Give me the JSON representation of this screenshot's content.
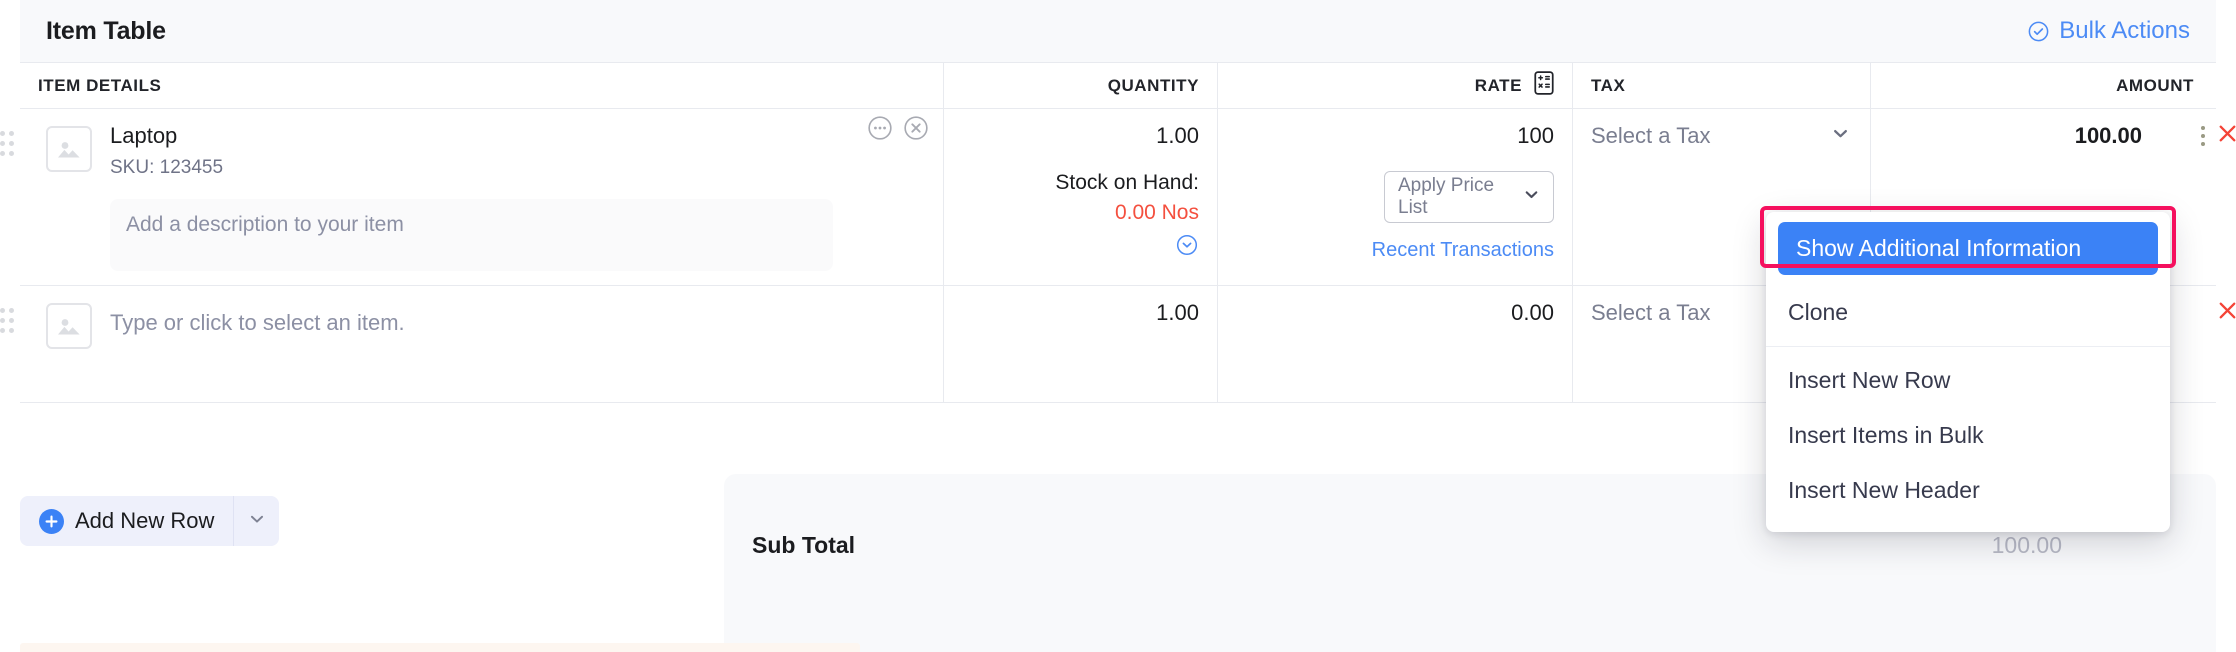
{
  "header": {
    "title": "Item Table",
    "bulk_actions_label": "Bulk Actions",
    "bulk_actions_icon": "check-circle-icon",
    "accent_blue": "#4c8bf5"
  },
  "table": {
    "columns": [
      {
        "key": "item",
        "label": "ITEM DETAILS"
      },
      {
        "key": "quantity",
        "label": "QUANTITY"
      },
      {
        "key": "rate",
        "label": "RATE",
        "icon": "calculator-icon"
      },
      {
        "key": "tax",
        "label": "TAX"
      },
      {
        "key": "amount",
        "label": "AMOUNT"
      }
    ],
    "rows": [
      {
        "image_icon": "image-placeholder-icon",
        "drag_icon": "drag-handle-icon",
        "name": "Laptop",
        "sku": "SKU: 123455",
        "description_placeholder": "Add a description to your item",
        "more_icon": "more-circle-icon",
        "remove_icon": "remove-circle-icon",
        "quantity": "1.00",
        "stock_label": "Stock on Hand:",
        "stock_value": "0.00 Nos",
        "stock_value_color": "#f4503f",
        "stock_expand_icon": "chevron-down-circle-icon",
        "rate": "100",
        "price_list_label": "Apply Price List",
        "price_list_icon": "chevron-down-icon",
        "recent_transactions_label": "Recent Transactions",
        "tax": "Select a Tax",
        "tax_icon": "chevron-down-icon",
        "amount": "100.00",
        "kebab_icon": "kebab-menu-icon",
        "delete_icon": "close-x-icon"
      },
      {
        "image_icon": "image-placeholder-icon",
        "drag_icon": "drag-handle-icon",
        "name_placeholder": "Type or click to select an item.",
        "quantity": "1.00",
        "rate": "0.00",
        "tax": "Select a Tax",
        "amount": "",
        "delete_icon": "close-x-icon"
      }
    ]
  },
  "footer": {
    "add_new_row_label": "Add New Row",
    "add_new_row_icon": "plus-circle-icon",
    "add_new_row_caret_icon": "chevron-down-icon",
    "sub_total_label": "Sub Total",
    "sub_total_value": "100.00"
  },
  "context_menu": {
    "highlighted_item": "Show Additional Information",
    "highlight_color": "#f5105e",
    "primary_bg": "#3b82f6",
    "items": [
      "Clone",
      "Insert New Row",
      "Insert Items in Bulk",
      "Insert New Header"
    ]
  }
}
